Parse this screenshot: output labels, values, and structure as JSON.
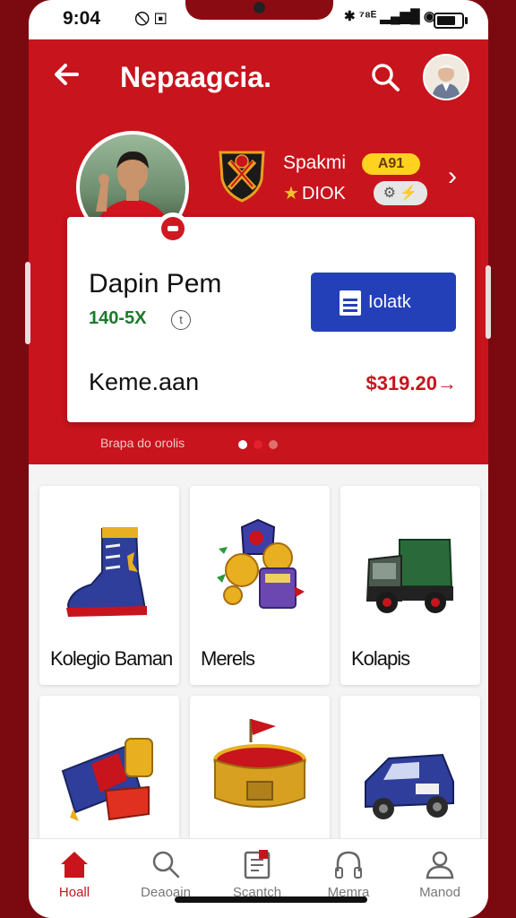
{
  "status_bar": {
    "time": "9:04",
    "left_icons": "🛇 ▣",
    "right_icons": "✱ ⁷⁸ᴱ ▂▄▆█ ◉",
    "battery_level": 0.75
  },
  "app_bar": {
    "back_icon": "arrow-left-icon",
    "title": "Nepaagcia.",
    "search_icon": "search-icon",
    "avatar_icon": "user-avatar"
  },
  "profile": {
    "name": "Spakmi",
    "rating": "A91",
    "team_code": "DIOK",
    "team_star": "★",
    "pill_icons": "⚙ ⚡",
    "chevron": "›",
    "colors": {
      "accent": "#c8141c",
      "badge": "#ffd21f"
    }
  },
  "card": {
    "title": "Dapin Pem",
    "stat": "140-5X",
    "info_icon": "t",
    "button_label": "Iolatk",
    "subtitle": "Keme.aan",
    "amount": "$319.20→"
  },
  "carousel": {
    "hint": "Brapa do orolis"
  },
  "tiles": [
    {
      "label": "Kolegio Baman",
      "icon": "boot-icon"
    },
    {
      "label": "Merels",
      "icon": "collectibles-icon"
    },
    {
      "label": "Kolapis",
      "icon": "truck-icon"
    },
    {
      "label": "",
      "icon": "scarf-icon"
    },
    {
      "label": "",
      "icon": "drum-icon"
    },
    {
      "label": "",
      "icon": "car-icon"
    }
  ],
  "bottom_nav": [
    {
      "label": "Hoall",
      "icon": "home-icon",
      "active": true
    },
    {
      "label": "Deaoain",
      "icon": "search-icon",
      "active": false
    },
    {
      "label": "Scantch",
      "icon": "scan-icon",
      "active": false
    },
    {
      "label": "Memra",
      "icon": "headphones-icon",
      "active": false
    },
    {
      "label": "Manod",
      "icon": "profile-icon",
      "active": false
    }
  ]
}
